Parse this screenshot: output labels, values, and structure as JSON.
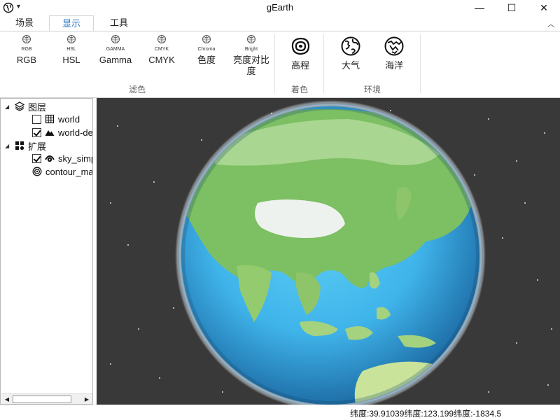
{
  "window": {
    "title": "gEarth",
    "minimize": "—",
    "maximize": "☐",
    "close": "✕"
  },
  "tabs": [
    {
      "label": "场景",
      "active": false
    },
    {
      "label": "显示",
      "active": true
    },
    {
      "label": "工具",
      "active": false
    }
  ],
  "ribbon": {
    "filter_group": {
      "label": "滤色",
      "buttons": [
        {
          "mini": "RGB",
          "label": "RGB"
        },
        {
          "mini": "HSL",
          "label": "HSL"
        },
        {
          "mini": "GAMMA",
          "label": "Gamma"
        },
        {
          "mini": "CMYK",
          "label": "CMYK"
        },
        {
          "mini": "Chroma",
          "label": "色度"
        },
        {
          "mini": "Bright",
          "label": "亮度对比",
          "label2": "度"
        }
      ]
    },
    "color_group": {
      "label": "着色",
      "buttons": [
        {
          "label": "高程"
        }
      ]
    },
    "env_group": {
      "label": "环境",
      "buttons": [
        {
          "label": "大气"
        },
        {
          "label": "海洋"
        }
      ]
    }
  },
  "tree": {
    "layers": {
      "label": "图层",
      "items": [
        {
          "label": "world",
          "checked": false
        },
        {
          "label": "world-dem",
          "checked": true
        }
      ]
    },
    "extensions": {
      "label": "扩展",
      "items": [
        {
          "label": "sky_simple",
          "checked": true
        },
        {
          "label": "contour_map"
        }
      ]
    }
  },
  "status": {
    "coords": "纬度:39.91039纬度:123.199纬度:-1834.5"
  },
  "colors": {
    "accent": "#1e6fc4",
    "space": "#393939",
    "ocean": "#3fb4ea",
    "land": "#7dbf63"
  }
}
